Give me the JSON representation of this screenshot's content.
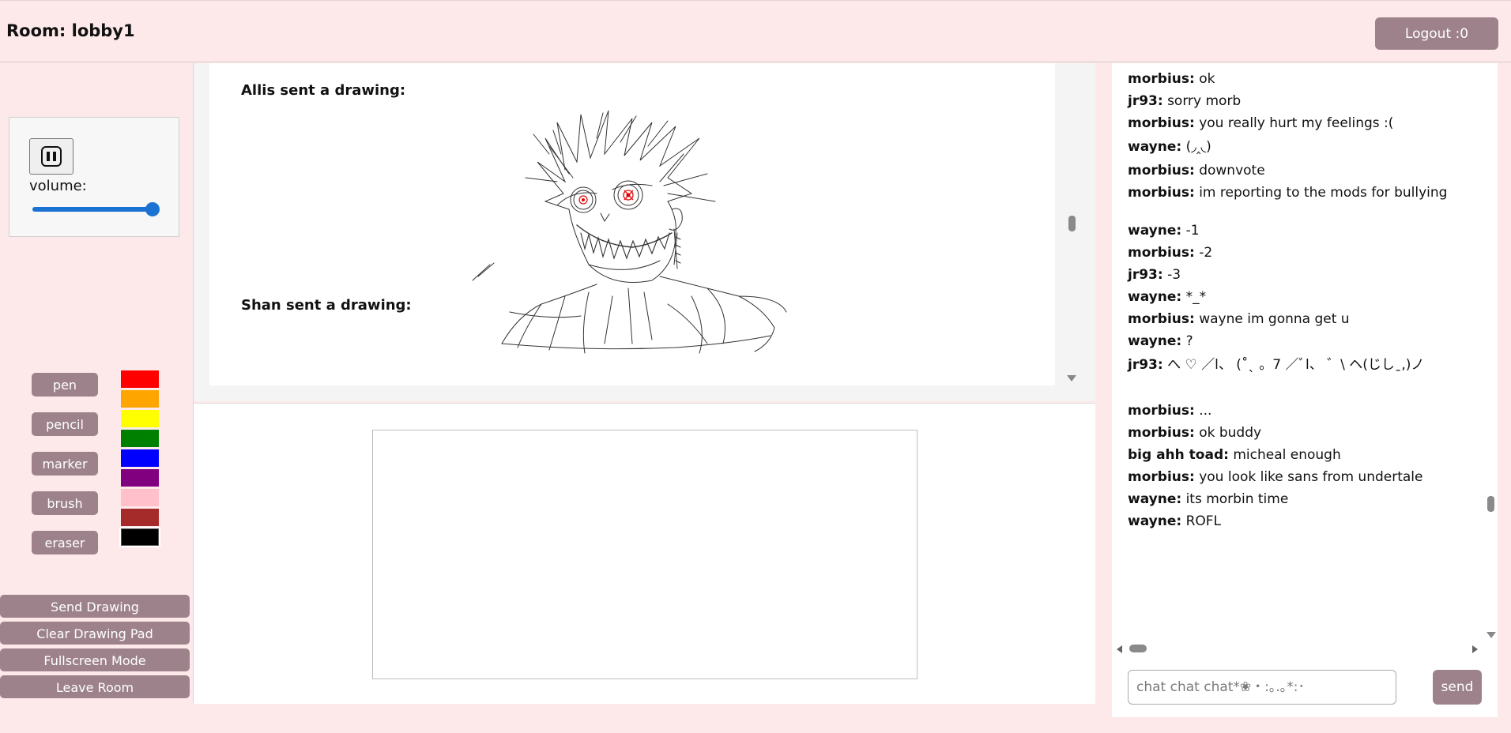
{
  "header": {
    "room_title": "Room: lobby1",
    "logout_label": "Logout :0"
  },
  "player": {
    "pause_icon": "pause-icon",
    "volume_label": "volume:",
    "volume_level_pct": 95
  },
  "tools": [
    "pen",
    "pencil",
    "marker",
    "brush",
    "eraser"
  ],
  "colors": [
    "#ff0000",
    "#ffa500",
    "#ffff00",
    "#008000",
    "#0000ff",
    "#800080",
    "#ffc0cb",
    "#a52a2a",
    "#000000"
  ],
  "selected_color": "#000000",
  "actions": [
    "Send Drawing",
    "Clear Drawing Pad",
    "Fullscreen Mode",
    "Leave Room"
  ],
  "feed": [
    {
      "caption": "Allis sent a drawing:"
    },
    {
      "caption": "Shan sent a drawing:"
    }
  ],
  "chat": {
    "messages": [
      {
        "user": "morbius:",
        "text": " ok"
      },
      {
        "user": "jr93:",
        "text": " sorry morb"
      },
      {
        "user": "morbius:",
        "text": " you really hurt my feelings :("
      },
      {
        "user": "wayne:",
        "text": " (◞‸◟) "
      },
      {
        "user": "morbius:",
        "text": " downvote"
      },
      {
        "user": "morbius:",
        "text": " im reporting to the mods for bullying"
      },
      {
        "user": "wayne:",
        "text": " -1"
      },
      {
        "user": "morbius:",
        "text": " -2"
      },
      {
        "user": "jr93:",
        "text": " -3"
      },
      {
        "user": "wayne:",
        "text": " *_*"
      },
      {
        "user": "morbius:",
        "text": " wayne im gonna get u"
      },
      {
        "user": "wayne:",
        "text": " ?"
      },
      {
        "user": "jr93:",
        "text": " へ ♡ ／l、 (˚ˎ 。7 ／ﾞl、 ゛\\ ヘ(じしˍ,)ノ"
      },
      {
        "user": "morbius:",
        "text": " ..."
      },
      {
        "user": "morbius:",
        "text": " ok buddy"
      },
      {
        "user": "big ahh toad:",
        "text": " micheal enough"
      },
      {
        "user": "morbius:",
        "text": " you look like sans from undertale"
      },
      {
        "user": "wayne:",
        "text": " its morbin time"
      },
      {
        "user": "wayne:",
        "text": " ROFL"
      }
    ],
    "input_placeholder": "chat chat chat*❀・:｡.｡*:･",
    "send_label": "send"
  }
}
